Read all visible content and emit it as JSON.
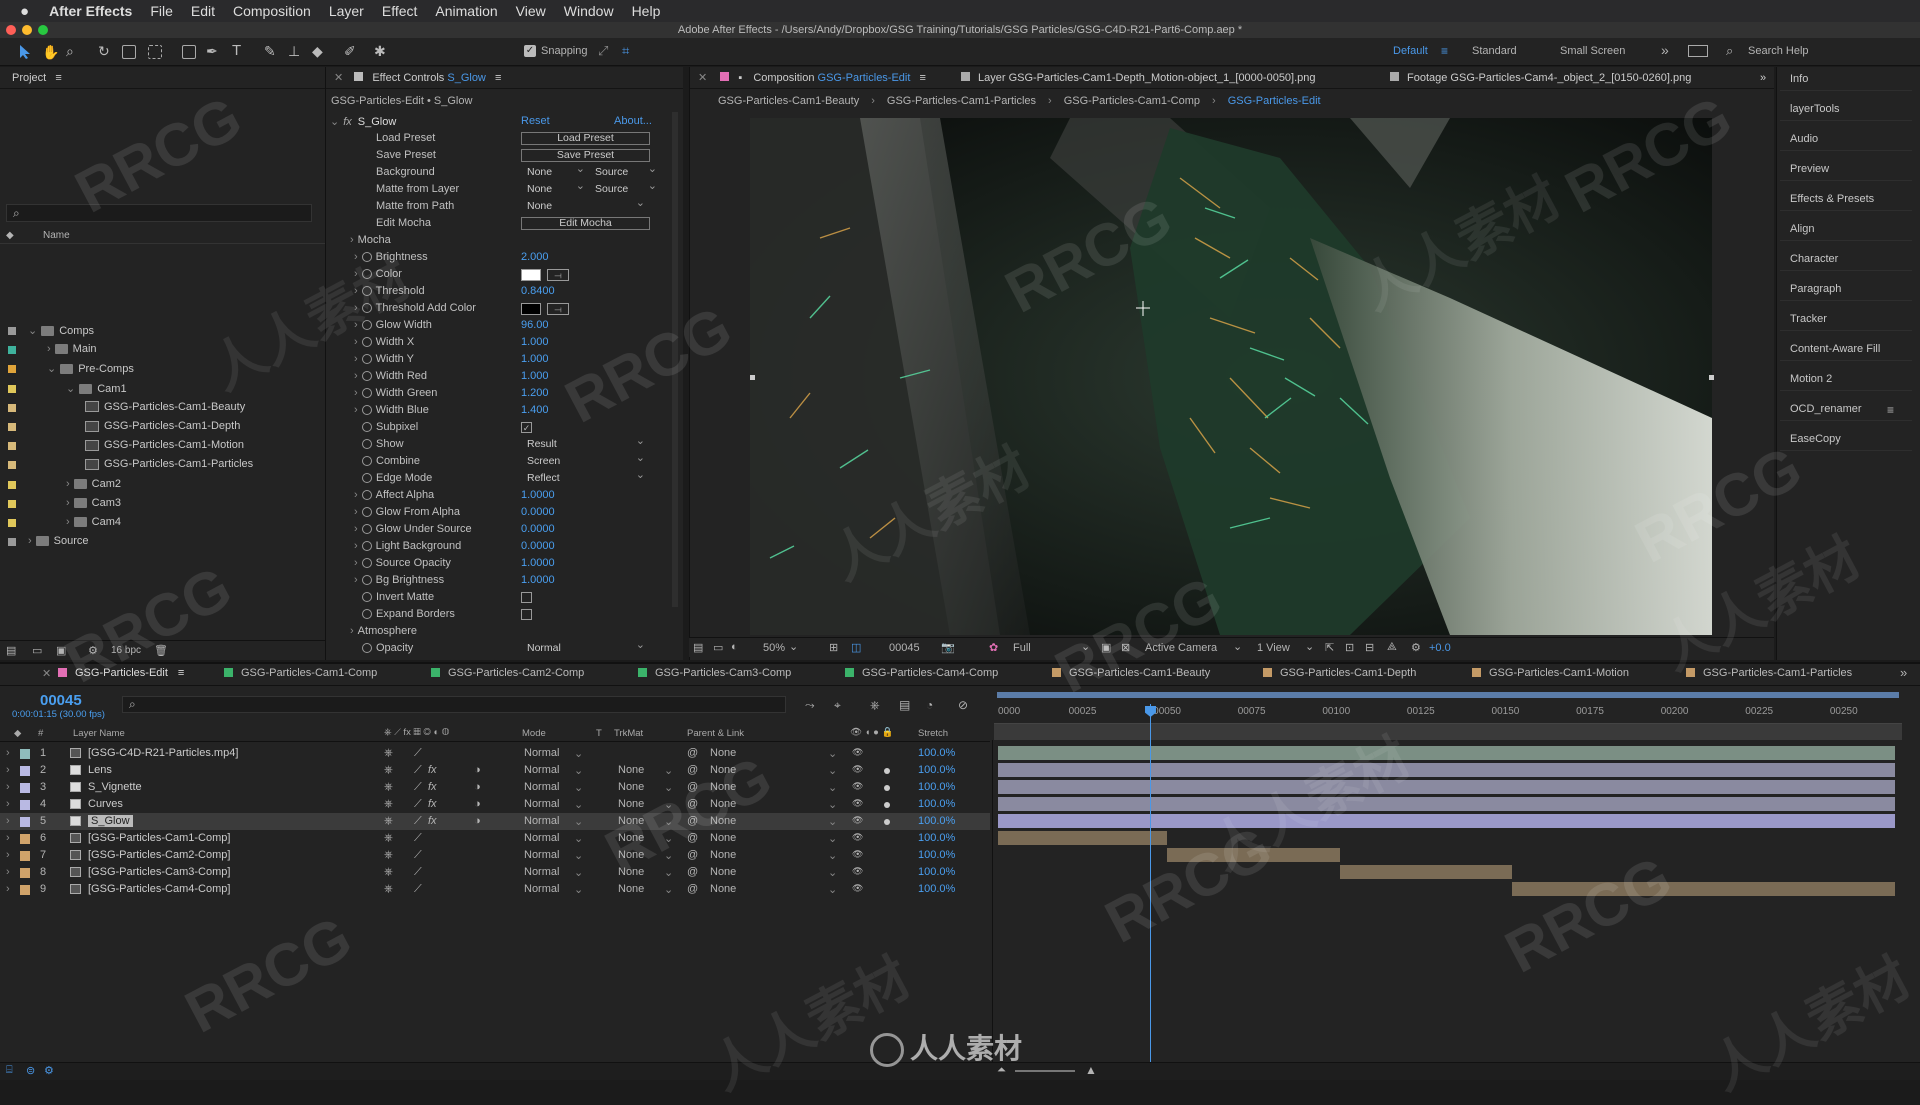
{
  "menubar": {
    "apple": "",
    "app": "After Effects",
    "items": [
      "File",
      "Edit",
      "Composition",
      "Layer",
      "Effect",
      "Animation",
      "View",
      "Window",
      "Help"
    ]
  },
  "window_title": "Adobe After Effects - /Users/Andy/Dropbox/GSG Training/Tutorials/GSG Particles/GSG-C4D-R21-Part6-Comp.aep *",
  "toolbar": {
    "snapping": "Snapping",
    "workspaces": [
      "Default",
      "Standard",
      "Small Screen"
    ],
    "search_help": "Search Help"
  },
  "project": {
    "title": "Project",
    "col_name": "Name",
    "bpc": "16 bpc",
    "tree": [
      {
        "label": "Comps",
        "type": "folder",
        "level": 0,
        "color": "#9a9a9a"
      },
      {
        "label": "Main",
        "type": "folder",
        "level": 1,
        "color": "#3fb39d"
      },
      {
        "label": "Pre-Comps",
        "type": "folder",
        "level": 1,
        "color": "#e0a43a"
      },
      {
        "label": "Cam1",
        "type": "folder",
        "level": 2,
        "color": "#e0c75a"
      },
      {
        "label": "GSG-Particles-Cam1-Beauty",
        "type": "comp",
        "level": 3,
        "color": "#d7b97a"
      },
      {
        "label": "GSG-Particles-Cam1-Depth",
        "type": "comp",
        "level": 3,
        "color": "#d7b97a"
      },
      {
        "label": "GSG-Particles-Cam1-Motion",
        "type": "comp",
        "level": 3,
        "color": "#d7b97a"
      },
      {
        "label": "GSG-Particles-Cam1-Particles",
        "type": "comp",
        "level": 3,
        "color": "#d7b97a"
      },
      {
        "label": "Cam2",
        "type": "folder",
        "level": 2,
        "color": "#e0c75a"
      },
      {
        "label": "Cam3",
        "type": "folder",
        "level": 2,
        "color": "#e0c75a"
      },
      {
        "label": "Cam4",
        "type": "folder",
        "level": 2,
        "color": "#e0c75a"
      },
      {
        "label": "Source",
        "type": "folder",
        "level": 0,
        "color": "#9a9a9a"
      }
    ]
  },
  "effect_controls": {
    "tab_prefix": "Effect Controls",
    "tab_layer": "S_Glow",
    "header": "GSG-Particles-Edit • S_Glow",
    "effect_name": "S_Glow",
    "reset": "Reset",
    "about": "About...",
    "load_preset": "Load Preset",
    "save_preset": "Save Preset",
    "edit_mocha": "Edit Mocha",
    "rows": [
      {
        "label": "Load Preset",
        "kind": "button",
        "value": "Load Preset"
      },
      {
        "label": "Save Preset",
        "kind": "button",
        "value": "Save Preset"
      },
      {
        "label": "Background",
        "kind": "dd2",
        "value": "None",
        "value2": "Source"
      },
      {
        "label": "Matte from Layer",
        "kind": "dd2",
        "value": "None",
        "value2": "Source"
      },
      {
        "label": "Matte from Path",
        "kind": "dd",
        "value": "None"
      },
      {
        "label": "Edit Mocha",
        "kind": "button",
        "value": "Edit Mocha"
      },
      {
        "label": "Mocha",
        "kind": "group"
      },
      {
        "label": "Brightness",
        "kind": "num",
        "value": "2.000"
      },
      {
        "label": "Color",
        "kind": "color",
        "value": "#ffffff"
      },
      {
        "label": "Threshold",
        "kind": "num",
        "value": "0.8400"
      },
      {
        "label": "Threshold Add Color",
        "kind": "color",
        "value": "#000000"
      },
      {
        "label": "Glow Width",
        "kind": "num",
        "value": "96.00"
      },
      {
        "label": "Width X",
        "kind": "num",
        "value": "1.000"
      },
      {
        "label": "Width Y",
        "kind": "num",
        "value": "1.000"
      },
      {
        "label": "Width Red",
        "kind": "num",
        "value": "1.000"
      },
      {
        "label": "Width Green",
        "kind": "num",
        "value": "1.200"
      },
      {
        "label": "Width Blue",
        "kind": "num",
        "value": "1.400"
      },
      {
        "label": "Subpixel",
        "kind": "check",
        "value": "✓"
      },
      {
        "label": "Show",
        "kind": "dd",
        "value": "Result"
      },
      {
        "label": "Combine",
        "kind": "dd",
        "value": "Screen"
      },
      {
        "label": "Edge Mode",
        "kind": "dd",
        "value": "Reflect"
      },
      {
        "label": "Affect Alpha",
        "kind": "num",
        "value": "1.0000"
      },
      {
        "label": "Glow From Alpha",
        "kind": "num",
        "value": "0.0000"
      },
      {
        "label": "Glow Under Source",
        "kind": "num",
        "value": "0.0000"
      },
      {
        "label": "Light Background",
        "kind": "num",
        "value": "0.0000"
      },
      {
        "label": "Source Opacity",
        "kind": "num",
        "value": "1.0000"
      },
      {
        "label": "Bg Brightness",
        "kind": "num",
        "value": "1.0000"
      },
      {
        "label": "Invert Matte",
        "kind": "check",
        "value": ""
      },
      {
        "label": "Expand Borders",
        "kind": "check",
        "value": ""
      },
      {
        "label": "Atmosphere",
        "kind": "group"
      },
      {
        "label": "Opacity",
        "kind": "dd",
        "value": "Normal"
      }
    ]
  },
  "composition": {
    "tab_prefix": "Composition",
    "tab_comp": "GSG-Particles-Edit",
    "layer_tab": "Layer GSG-Particles-Cam1-Depth_Motion-object_1_[0000-0050].png",
    "footage_tab": "Footage GSG-Particles-Cam4-_object_2_[0150-0260].png",
    "breadcrumbs": [
      "GSG-Particles-Cam1-Beauty",
      "GSG-Particles-Cam1-Particles",
      "GSG-Particles-Cam1-Comp",
      "GSG-Particles-Edit"
    ],
    "zoom": "50%",
    "frame": "00045",
    "resolution": "Full",
    "camera": "Active Camera",
    "view": "1 View",
    "exposure": "+0.0"
  },
  "right_panel": {
    "items": [
      "Info",
      "layerTools",
      "Audio",
      "Preview",
      "Effects & Presets",
      "Align",
      "Character",
      "Paragraph",
      "Tracker",
      "Content-Aware Fill",
      "Motion 2",
      "OCD_renamer",
      "EaseCopy"
    ]
  },
  "timeline": {
    "tabs": [
      {
        "label": "GSG-Particles-Edit",
        "color": "#e36fb5"
      },
      {
        "label": "GSG-Particles-Cam1-Comp",
        "color": "#3bb36a"
      },
      {
        "label": "GSG-Particles-Cam2-Comp",
        "color": "#3bb36a"
      },
      {
        "label": "GSG-Particles-Cam3-Comp",
        "color": "#3bb36a"
      },
      {
        "label": "GSG-Particles-Cam4-Comp",
        "color": "#3bb36a"
      },
      {
        "label": "GSG-Particles-Cam1-Beauty",
        "color": "#c49a66"
      },
      {
        "label": "GSG-Particles-Cam1-Depth",
        "color": "#c49a66"
      },
      {
        "label": "GSG-Particles-Cam1-Motion",
        "color": "#c49a66"
      },
      {
        "label": "GSG-Particles-Cam1-Particles",
        "color": "#c49a66"
      }
    ],
    "current_frame": "00045",
    "timecode": "0:00:01:15 (30.00 fps)",
    "columns": {
      "num": "#",
      "layer_name": "Layer Name",
      "mode": "Mode",
      "t": "T",
      "trkmat": "TrkMat",
      "parent": "Parent & Link",
      "stretch": "Stretch"
    },
    "ruler": [
      "0000",
      "00025",
      "00050",
      "00075",
      "00100",
      "00125",
      "00150",
      "00175",
      "00200",
      "00225",
      "00250"
    ],
    "layers": [
      {
        "num": "1",
        "name": "[GSG-C4D-R21-Particles.mp4]",
        "color": "#8fbcbc",
        "mode": "Normal",
        "trkmat": "",
        "parent": "None",
        "stretch": "100.0%",
        "fx": false,
        "bar_start": 0,
        "bar_end": 265,
        "bar_color": "#7b8f84"
      },
      {
        "num": "2",
        "name": "Lens",
        "color": "#b9b9e3",
        "mode": "Normal",
        "trkmat": "None",
        "parent": "None",
        "stretch": "100.0%",
        "fx": true,
        "bar_start": 0,
        "bar_end": 265,
        "bar_color": "#8a8aa0"
      },
      {
        "num": "3",
        "name": "S_Vignette",
        "color": "#b9b9e3",
        "mode": "Normal",
        "trkmat": "None",
        "parent": "None",
        "stretch": "100.0%",
        "fx": true,
        "bar_start": 0,
        "bar_end": 265,
        "bar_color": "#8a8aa0"
      },
      {
        "num": "4",
        "name": "Curves",
        "color": "#b9b9e3",
        "mode": "Normal",
        "trkmat": "None",
        "parent": "None",
        "stretch": "100.0%",
        "fx": true,
        "bar_start": 0,
        "bar_end": 265,
        "bar_color": "#8a8aa0"
      },
      {
        "num": "5",
        "name": "S_Glow",
        "color": "#b9b9e3",
        "mode": "Normal",
        "trkmat": "None",
        "parent": "None",
        "stretch": "100.0%",
        "fx": true,
        "bar_start": 0,
        "bar_end": 265,
        "bar_color": "#9a98c8",
        "selected": true
      },
      {
        "num": "6",
        "name": "[GSG-Particles-Cam1-Comp]",
        "color": "#d0a36a",
        "mode": "Normal",
        "trkmat": "None",
        "parent": "None",
        "stretch": "100.0%",
        "fx": false,
        "bar_start": 0,
        "bar_end": 50,
        "bar_color": "#7a6b55"
      },
      {
        "num": "7",
        "name": "[GSG-Particles-Cam2-Comp]",
        "color": "#d0a36a",
        "mode": "Normal",
        "trkmat": "None",
        "parent": "None",
        "stretch": "100.0%",
        "fx": false,
        "bar_start": 50,
        "bar_end": 101,
        "bar_color": "#7a6b55"
      },
      {
        "num": "8",
        "name": "[GSG-Particles-Cam3-Comp]",
        "color": "#d0a36a",
        "mode": "Normal",
        "trkmat": "None",
        "parent": "None",
        "stretch": "100.0%",
        "fx": false,
        "bar_start": 101,
        "bar_end": 152,
        "bar_color": "#7a6b55"
      },
      {
        "num": "9",
        "name": "[GSG-Particles-Cam4-Comp]",
        "color": "#d0a36a",
        "mode": "Normal",
        "trkmat": "None",
        "parent": "None",
        "stretch": "100.0%",
        "fx": false,
        "bar_start": 152,
        "bar_end": 265,
        "bar_color": "#7a6b55"
      }
    ]
  },
  "watermarks": {
    "latin": "RRCG",
    "cjk": "人人素材",
    "footer": "人人素材"
  }
}
